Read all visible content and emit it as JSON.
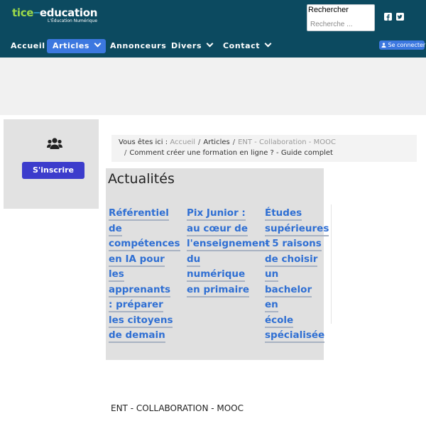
{
  "header": {
    "logo_tice": "tice",
    "logo_dash": "—",
    "logo_education": "education",
    "logo_tagline": "L'Éducation Numérique",
    "search_label": "Rechercher",
    "search_placeholder": "Recherche ...",
    "connect_label": "Se connecter"
  },
  "nav": {
    "items": [
      {
        "label": "Accueil"
      },
      {
        "label": "Articles"
      },
      {
        "label": "Annonceurs"
      },
      {
        "label": "Divers"
      },
      {
        "label": "Contact"
      }
    ]
  },
  "side": {
    "signup_label": "S'inscrire"
  },
  "breadcrumb": {
    "prefix": "Vous êtes ici :",
    "items": [
      "Accueil",
      "Articles",
      "ENT - Collaboration - MOOC",
      "Comment créer une formation en ligne ? - Guide complet"
    ]
  },
  "news": {
    "title": "Actualités",
    "articles": [
      {
        "lines": [
          "Référentiel",
          "de",
          "compétences",
          "en IA pour",
          "les",
          "apprenants",
          ": préparer",
          "les citoyens",
          "de demain"
        ]
      },
      {
        "lines": [
          "Pix Junior :",
          "au cœur de",
          "l'enseignement",
          "du",
          "numérique",
          "en primaire"
        ]
      },
      {
        "lines": [
          "Études",
          "supérieures",
          "- 5 raisons",
          "de choisir",
          "un",
          "bachelor en",
          "école",
          "spécialisée"
        ]
      }
    ]
  },
  "section_footer": "ENT - COLLABORATION - MOOC",
  "colors": {
    "header_bg": "#0c4a60",
    "accent_blue": "#3c78e0",
    "link_blue": "#2f6fd3",
    "signup_bg": "#3c3ccc"
  }
}
